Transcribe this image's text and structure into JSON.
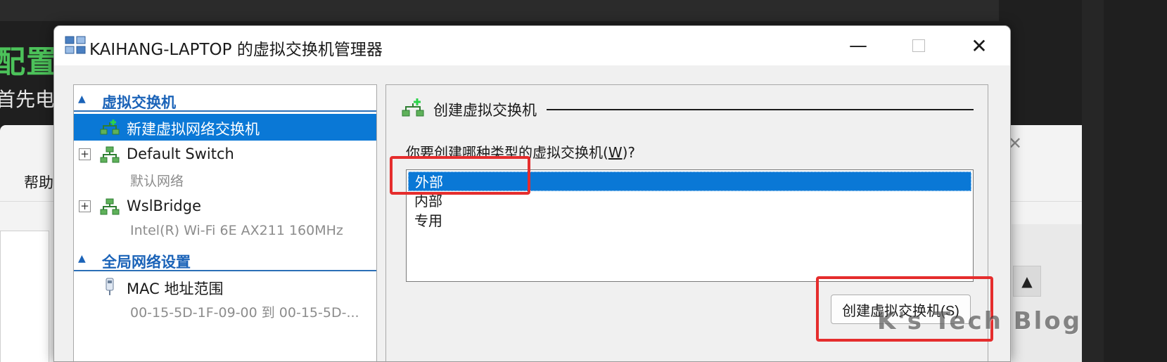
{
  "background": {
    "heading": "配置",
    "subtext": "首先电",
    "menu_help": "帮助",
    "close_glyph": "✕",
    "scroll_up_glyph": "▲"
  },
  "dialog": {
    "title": "KAIHANG-LAPTOP 的虚拟交换机管理器",
    "minimize_glyph": "—",
    "close_glyph": "✕"
  },
  "tree": {
    "section_switches": "虚拟交换机",
    "section_global": "全局网络设置",
    "new_switch": "新建虚拟网络交换机",
    "items": [
      {
        "label": "Default Switch",
        "sub": "默认网络"
      },
      {
        "label": "WslBridge",
        "sub": "Intel(R) Wi-Fi 6E AX211 160MHz"
      }
    ],
    "mac": {
      "label": "MAC 地址范围",
      "sub": "00-15-5D-1F-09-00 到 00-15-5D-..."
    },
    "expander_glyph": "+",
    "collapse_glyph": "⌃"
  },
  "detail": {
    "header": "创建虚拟交换机",
    "question_prefix": "你要创建哪种类型的虚拟交换机(",
    "question_key": "W",
    "question_suffix": ")?",
    "types": [
      "外部",
      "内部",
      "专用"
    ],
    "selected_type": "外部",
    "create_button": "创建虚拟交换机(S)"
  },
  "watermark": "K's Tech Blog",
  "colors": {
    "selection": "#0a78d6",
    "section_text": "#1b63b8",
    "callout": "#e52d2d",
    "heading_green": "#4cc25a"
  }
}
